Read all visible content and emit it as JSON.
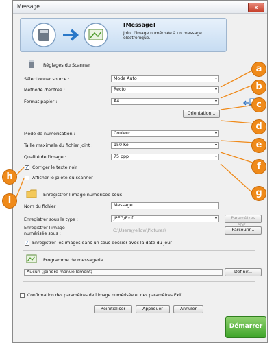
{
  "window": {
    "title": "Message",
    "close_label": "x"
  },
  "banner": {
    "title": "[Message]",
    "description": "Joint l'image numérisée à un message électronique."
  },
  "scanner": {
    "group_title": "Réglages du Scanner",
    "select_source": {
      "label": "Sélectionner source :",
      "value": "Mode Auto"
    },
    "feed_method": {
      "label": "Méthode d'entrée :",
      "value": "Recto"
    },
    "paper_format": {
      "label": "Format papier :",
      "value": "A4"
    },
    "orientation_button": "Orientation...",
    "scan_mode": {
      "label": "Mode de numérisation :",
      "value": "Couleur"
    },
    "max_file_size": {
      "label": "Taille maximale du fichier joint :",
      "value": "150 Ko"
    },
    "image_quality": {
      "label": "Qualité de l'image :",
      "value": "75 ppp"
    },
    "correct_text": {
      "label": "Corriger le texte noir",
      "checked": true
    },
    "show_driver": {
      "label": "Afficher le pilote du scanner",
      "checked": false
    }
  },
  "save": {
    "group_title": "Enregistrer l'image numérisée sous",
    "filename": {
      "label": "Nom du fichier :",
      "value": "Message"
    },
    "type": {
      "label": "Enregistrer sous le type :",
      "value": "JPEG/Exif"
    },
    "pdf_settings_button": "Paramètres PDF...",
    "location": {
      "label_line1": "Enregistrer l'image",
      "label_line2": "numérisée sous :",
      "value": "C:\\Users\\yellow\\Pictures\\"
    },
    "browse_button": "Parcourir...",
    "subfolder": {
      "label": "Enregistrer les images dans un sous-dossier avec la date du jour",
      "checked": true
    }
  },
  "mail": {
    "group_title": "Programme de messagerie",
    "value": "Aucun (joindre manuellement)",
    "define_button": "Définir..."
  },
  "confirm": {
    "label": "Confirmation des paramètres de l'image numérisée et des paramètres Exif",
    "checked": false
  },
  "footer": {
    "reset": "Réinitialiser",
    "apply": "Appliquer",
    "cancel": "Annuler",
    "start": "Démarrer"
  },
  "markers": [
    "a",
    "b",
    "c",
    "d",
    "e",
    "f",
    "g",
    "h",
    "i"
  ],
  "colors": {
    "marker": "#ef8a1a",
    "start": "#3fa52a",
    "banner": "#c6dcf2"
  }
}
